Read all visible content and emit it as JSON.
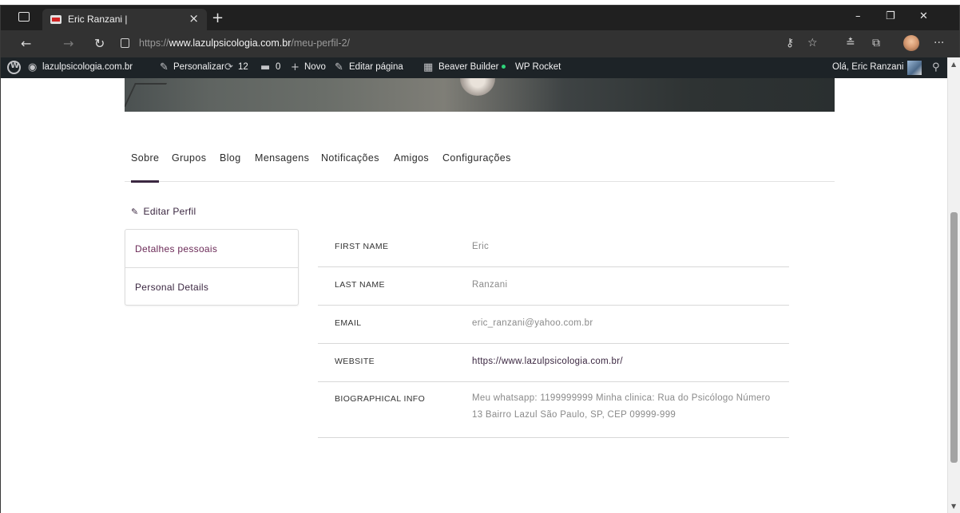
{
  "browser": {
    "tab_title": "Eric Ranzani |",
    "tab_close": "×",
    "new_tab": "+",
    "window_controls": {
      "minimize": "–",
      "maximize": "❐",
      "close": "✕"
    },
    "url_prefix": "https://",
    "url_domain": "www.lazulpsicologia.com.br",
    "url_path": "/meu-perfil-2/",
    "nav_icons": [
      "back-icon",
      "forward-icon",
      "refresh-icon",
      "lock-icon",
      "key-icon",
      "favorite-add-icon",
      "favorites-icon",
      "collections-icon",
      "profile-avatar",
      "more-icon"
    ]
  },
  "admin_bar": {
    "site_name": "lazulpsicologia.com.br",
    "customize": "Personalizar",
    "updates_count": "12",
    "comments_count": "0",
    "new": "Novo",
    "edit_page": "Editar página",
    "beaver_builder": "Beaver Builder",
    "wp_rocket": "WP Rocket",
    "greeting": "Olá, Eric Ranzani"
  },
  "profile_nav": {
    "tabs": [
      {
        "label": "Sobre",
        "active": true
      },
      {
        "label": "Grupos"
      },
      {
        "label": "Blog"
      },
      {
        "label": "Mensagens"
      },
      {
        "label": "Notificações"
      },
      {
        "label": "Amigos"
      },
      {
        "label": "Configurações"
      }
    ]
  },
  "edit_profile": {
    "label": "Editar Perfil"
  },
  "sidebar": {
    "items": [
      {
        "label": "Detalhes pessoais"
      },
      {
        "label": "Personal Details"
      }
    ]
  },
  "details": [
    {
      "label": "FIRST NAME",
      "value": "Eric"
    },
    {
      "label": "LAST NAME",
      "value": "Ranzani"
    },
    {
      "label": "EMAIL",
      "value": "eric_ranzani@yahoo.com.br"
    },
    {
      "label": "WEBSITE",
      "value": "https://www.lazulpsicologia.com.br/"
    },
    {
      "label": "BIOGRAPHICAL INFO",
      "value": "Meu whatsapp: 1199999999 Minha clinica: Rua do Psicólogo Número 13 Bairro Lazul São Paulo, SP, CEP 09999-999"
    }
  ],
  "colors": {
    "accent": "#3b2741",
    "accent_link": "#6b2a57",
    "admin_bar_bg": "#1d2327",
    "browser_bg": "#202020"
  }
}
